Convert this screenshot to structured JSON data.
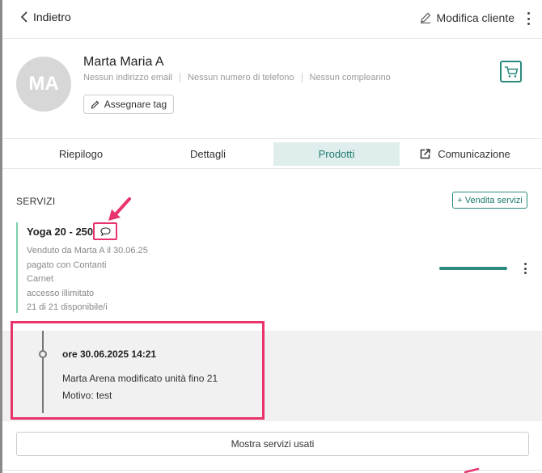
{
  "header": {
    "back_label": "Indietro",
    "edit_label": "Modifica cliente"
  },
  "profile": {
    "initials": "MA",
    "name": "Marta Maria A",
    "email": "Nessun indirizzo email",
    "phone": "Nessun numero di telefono",
    "birthday": "Nessun compleanno",
    "tag_button": "Assegnare tag"
  },
  "tabs": [
    {
      "label": "Riepilogo",
      "active": false
    },
    {
      "label": "Dettagli",
      "active": false
    },
    {
      "label": "Prodotti",
      "active": true
    },
    {
      "label": "Comunicazione",
      "active": false
    }
  ],
  "services": {
    "title": "SERVIZI",
    "sell_button": "+ Vendita servizi",
    "item": {
      "title": "Yoga 20 - 250 €",
      "lines": [
        "Venduto da Marta A il 30.06.25",
        "pagato con Contanti",
        "Carnet",
        "accesso illimitato",
        "21 di 21 disponibile/i"
      ],
      "remaining_fraction": 1.0
    }
  },
  "history": {
    "date": "ore 30.06.2025 14:21",
    "line1": "Marta Arena modificato unità fino 21",
    "line2": "Motivo: test"
  },
  "show_used_button": "Mostra servizi usati",
  "colors": {
    "accent": "#2c8a7d",
    "highlight": "#e8336b",
    "active_tab_bg": "#dfeeed",
    "service_border": "#7bd1ad"
  },
  "icons": [
    "chevron-left-icon",
    "pencil-icon",
    "kebab-icon",
    "cart-icon",
    "external-link-icon",
    "comment-icon"
  ]
}
